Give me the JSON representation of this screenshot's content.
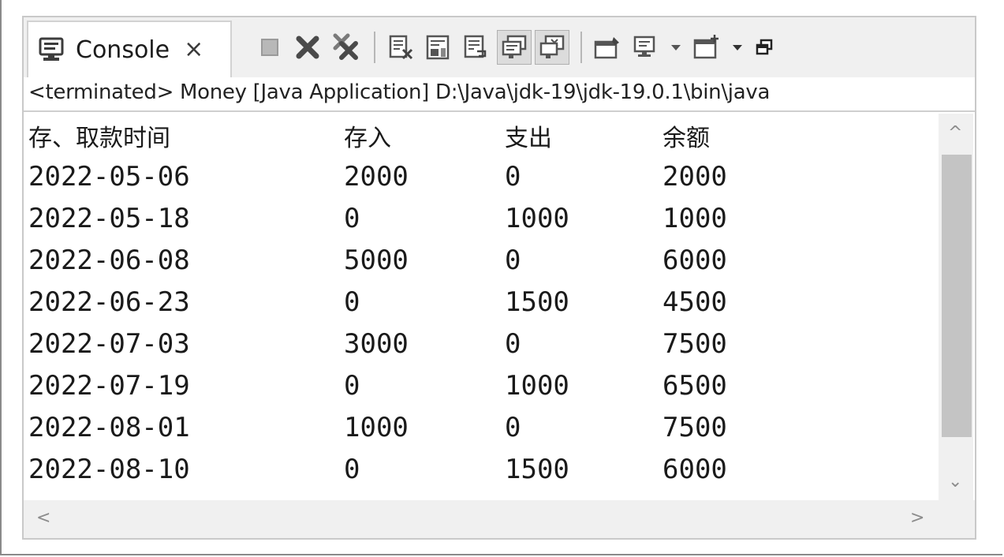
{
  "tab": {
    "label": "Console",
    "close_glyph": "×",
    "icon": "console-icon"
  },
  "toolbar": {
    "items": [
      {
        "icon": "terminate-icon",
        "state": "disabled"
      },
      {
        "icon": "remove-launch-icon",
        "state": "enabled"
      },
      {
        "icon": "remove-all-terminated-icon",
        "state": "enabled"
      },
      {
        "icon": "separator"
      },
      {
        "icon": "clear-console-icon",
        "state": "enabled"
      },
      {
        "icon": "scroll-lock-icon",
        "state": "enabled"
      },
      {
        "icon": "word-wrap-icon",
        "state": "enabled"
      },
      {
        "icon": "show-console-stdout-icon",
        "state": "pressed"
      },
      {
        "icon": "show-console-stderr-icon",
        "state": "pressed"
      },
      {
        "icon": "separator"
      },
      {
        "icon": "pin-console-icon",
        "state": "enabled"
      },
      {
        "icon": "display-selected-console-icon",
        "state": "enabled"
      },
      {
        "icon": "dropdown-arrow-icon"
      },
      {
        "icon": "open-console-icon",
        "state": "enabled"
      },
      {
        "icon": "dropdown-arrow-icon"
      },
      {
        "icon": "restore-view-icon",
        "state": "enabled"
      }
    ]
  },
  "path_line": "<terminated> Money [Java Application] D:\\Java\\jdk-19\\jdk-19.0.1\\bin\\java",
  "console": {
    "header": [
      "存、取款时间",
      "存入",
      "支出",
      "余额"
    ],
    "rows": [
      [
        "2022-05-06",
        "2000",
        "0",
        "2000"
      ],
      [
        "2022-05-18",
        "0",
        "1000",
        "1000"
      ],
      [
        "2022-06-08",
        "5000",
        "0",
        "6000"
      ],
      [
        "2022-06-23",
        "0",
        "1500",
        "4500"
      ],
      [
        "2022-07-03",
        "3000",
        "0",
        "7500"
      ],
      [
        "2022-07-19",
        "0",
        "1000",
        "6500"
      ],
      [
        "2022-08-01",
        "1000",
        "0",
        "7500"
      ],
      [
        "2022-08-10",
        "0",
        "1500",
        "6000"
      ]
    ]
  },
  "scroll": {
    "up": "^",
    "down": "⌄",
    "left": "<",
    "right": ">"
  },
  "colors": {
    "icon_gray": "#5a5a5a",
    "toolbar_bg": "#f0f0f0",
    "scroll_thumb": "#c4c4c4"
  }
}
